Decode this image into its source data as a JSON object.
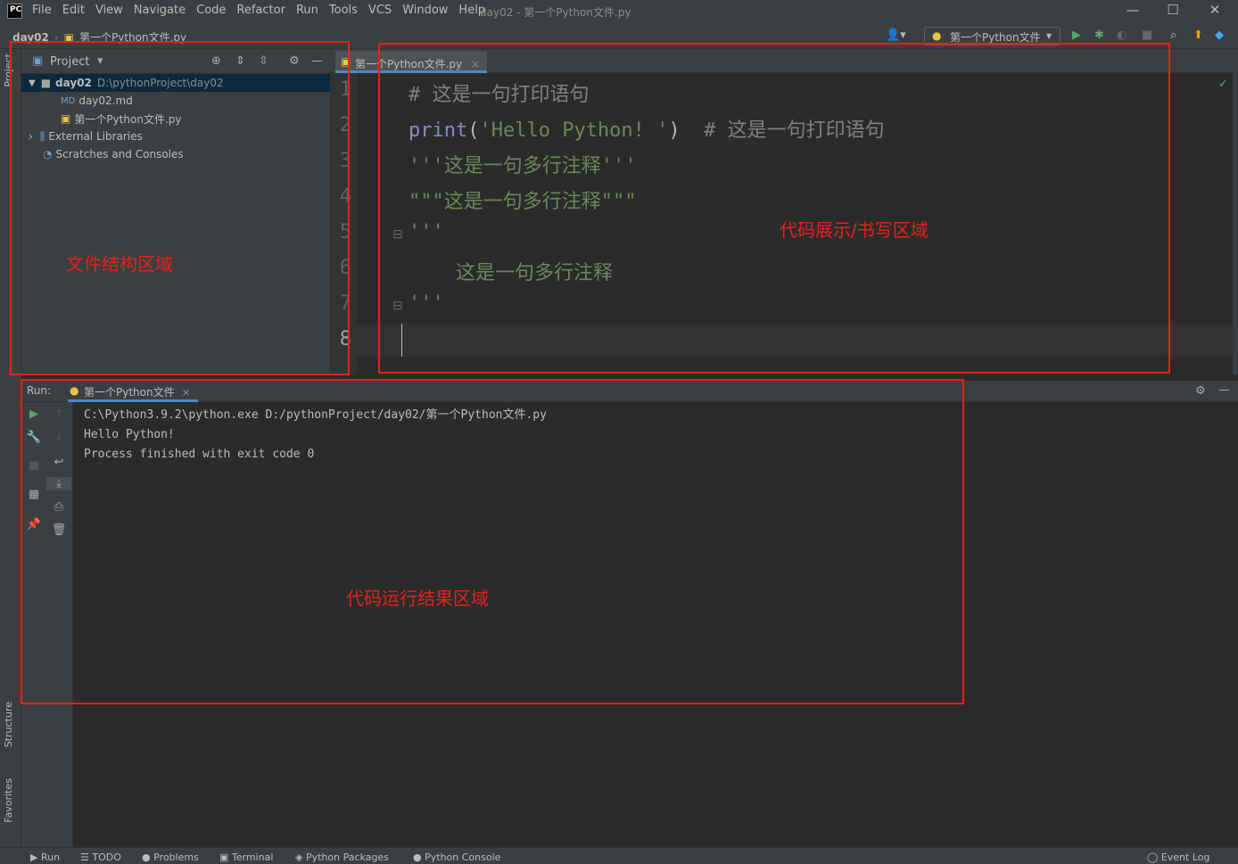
{
  "app": {
    "logo_text": "PC",
    "window_title": "day02 - 第一个Python文件.py"
  },
  "menu": [
    "File",
    "Edit",
    "View",
    "Navigate",
    "Code",
    "Refactor",
    "Run",
    "Tools",
    "VCS",
    "Window",
    "Help"
  ],
  "window_controls": {
    "minimize": "—",
    "maximize": "☐",
    "close": "✕"
  },
  "breadcrumb": {
    "project": "day02",
    "file": "第一个Python文件.py"
  },
  "run_config": {
    "selected": "第一个Python文件"
  },
  "left_strip": {
    "project": "Project",
    "structure": "Structure",
    "favorites": "Favorites"
  },
  "project_panel": {
    "title": "Project",
    "root": {
      "name": "day02",
      "path": "D:\\pythonProject\\day02"
    },
    "files": [
      {
        "name": "day02.md",
        "icon": "markdown-file-icon"
      },
      {
        "name": "第一个Python文件.py",
        "icon": "python-file-icon"
      }
    ],
    "external": "External Libraries",
    "scratches": "Scratches and Consoles"
  },
  "editor": {
    "tab": "第一个Python文件.py",
    "line_numbers": [
      "1",
      "2",
      "3",
      "4",
      "5",
      "6",
      "7",
      "8"
    ],
    "lines": {
      "l1": "# 这是一句打印语句",
      "l2_fn": "print",
      "l2_paren_open": "(",
      "l2_str": "'Hello Python! '",
      "l2_paren_close": ")",
      "l2_comment": "  # 这是一句打印语句",
      "l3": "'''这是一句多行注释'''",
      "l4": "\"\"\"这是一句多行注释\"\"\"",
      "l5": "'''",
      "l6": "    这是一句多行注释",
      "l7": "'''"
    }
  },
  "run_panel": {
    "label": "Run:",
    "tab": "第一个Python文件",
    "console": [
      "C:\\Python3.9.2\\python.exe D:/pythonProject/day02/第一个Python文件.py",
      "Hello Python!",
      "",
      "Process finished with exit code 0"
    ]
  },
  "status_bar": {
    "run": "Run",
    "todo": "TODO",
    "problems": "Problems",
    "terminal": "Terminal",
    "packages": "Python Packages",
    "console": "Python Console",
    "event_log": "Event Log"
  },
  "annotations": {
    "file_structure": "文件结构区域",
    "code_area": "代码展示/书写区域",
    "run_result": "代码运行结果区域",
    "box_color": "#e8201a"
  }
}
